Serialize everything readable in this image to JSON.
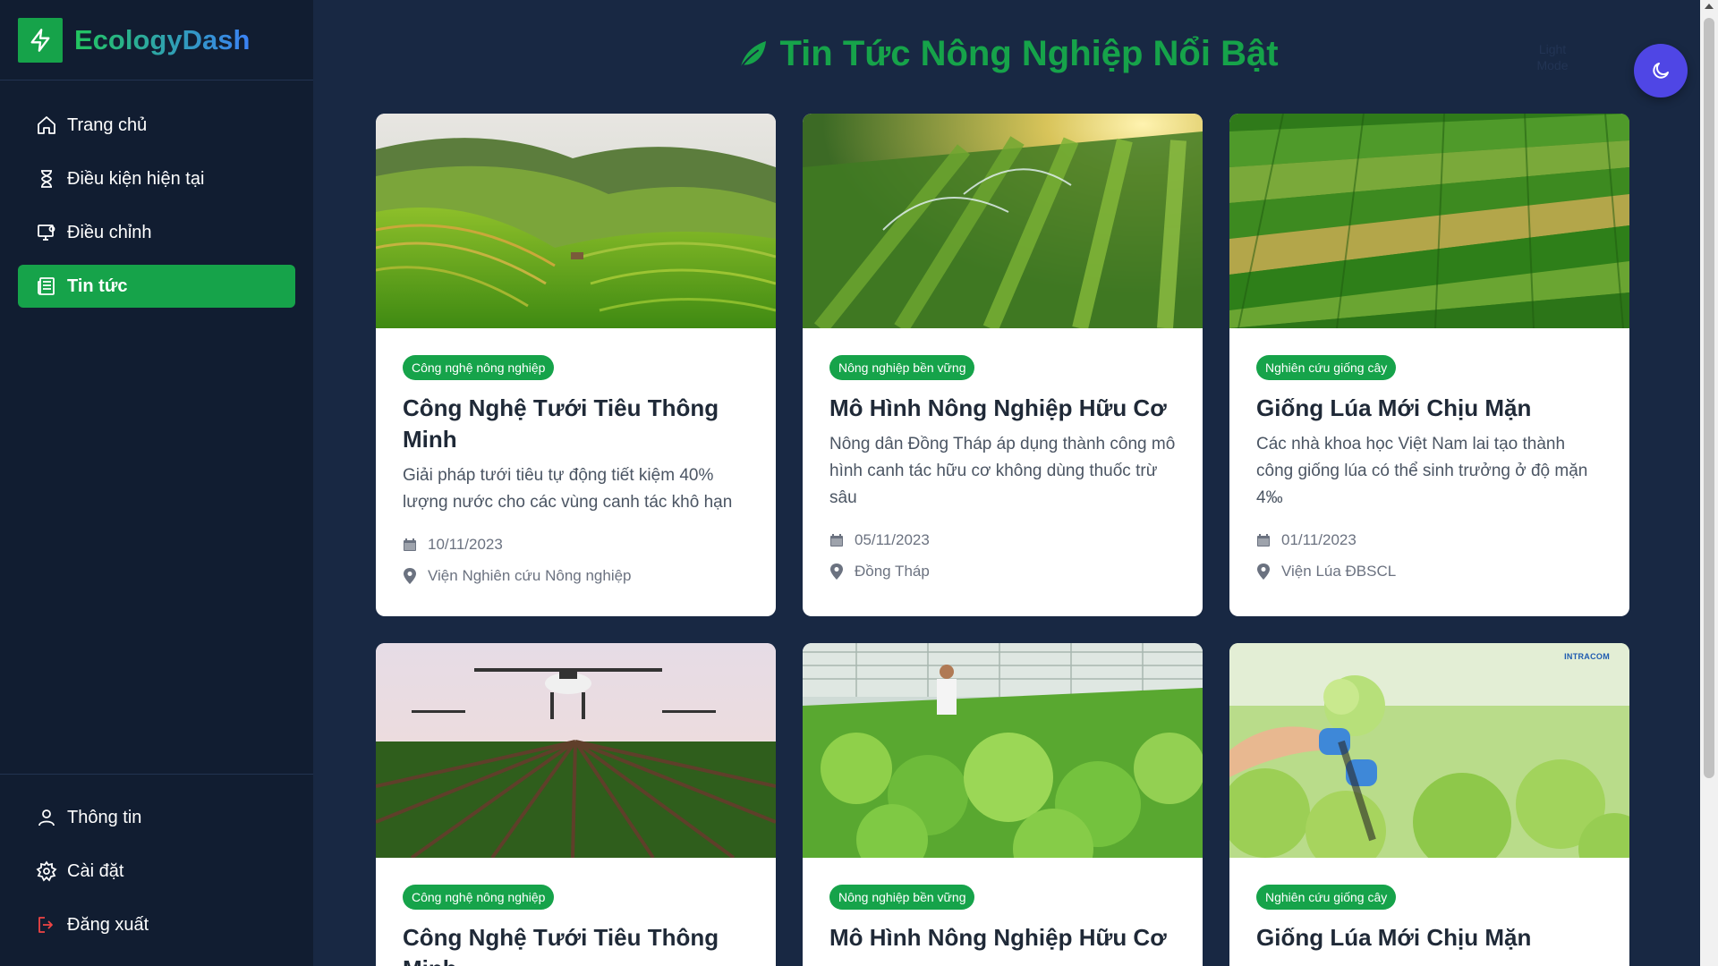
{
  "brand": {
    "name": "EcologyDash"
  },
  "sidebar": {
    "items": [
      {
        "label": "Trang chủ",
        "icon": "home-icon"
      },
      {
        "label": "Điều kiện hiện tại",
        "icon": "hourglass-icon"
      },
      {
        "label": "Điều chỉnh",
        "icon": "monitor-settings-icon"
      },
      {
        "label": "Tin tức",
        "icon": "newspaper-icon",
        "active": true
      }
    ],
    "bottom_items": [
      {
        "label": "Thông tin",
        "icon": "user-icon"
      },
      {
        "label": "Cài đặt",
        "icon": "gear-icon"
      },
      {
        "label": "Đăng xuất",
        "icon": "logout-icon"
      }
    ]
  },
  "header": {
    "title": "Tin Tức Nông Nghiệp Nổi Bật",
    "theme_hint": "Light Mode"
  },
  "colors": {
    "accent": "#16a34a",
    "background": "#182843",
    "sidebar": "#111d31",
    "toggle": "#4f46e5"
  },
  "cards": [
    {
      "tag": "Công nghệ nông nghiệp",
      "title": "Công Nghệ Tưới Tiêu Thông Minh",
      "desc": "Giải pháp tưới tiêu tự động tiết kiệm 40% lượng nước cho các vùng canh tác khô hạn",
      "date": "10/11/2023",
      "location": "Viện Nghiên cứu Nông nghiệp"
    },
    {
      "tag": "Nông nghiệp bền vững",
      "title": "Mô Hình Nông Nghiệp Hữu Cơ",
      "desc": "Nông dân Đồng Tháp áp dụng thành công mô hình canh tác hữu cơ không dùng thuốc trừ sâu",
      "date": "05/11/2023",
      "location": "Đồng Tháp"
    },
    {
      "tag": "Nghiên cứu giống cây",
      "title": "Giống Lúa Mới Chịu Mặn",
      "desc": "Các nhà khoa học Việt Nam lai tạo thành công giống lúa có thể sinh trưởng ở độ mặn 4‰",
      "date": "01/11/2023",
      "location": "Viện Lúa ĐBSCL"
    },
    {
      "tag": "Công nghệ nông nghiệp",
      "title": "Công Nghệ Tưới Tiêu Thông Minh"
    },
    {
      "tag": "Nông nghiệp bền vững",
      "title": "Mô Hình Nông Nghiệp Hữu Cơ"
    },
    {
      "tag": "Nghiên cứu giống cây",
      "title": "Giống Lúa Mới Chịu Mặn",
      "image_watermark": "INTRACOM"
    }
  ]
}
